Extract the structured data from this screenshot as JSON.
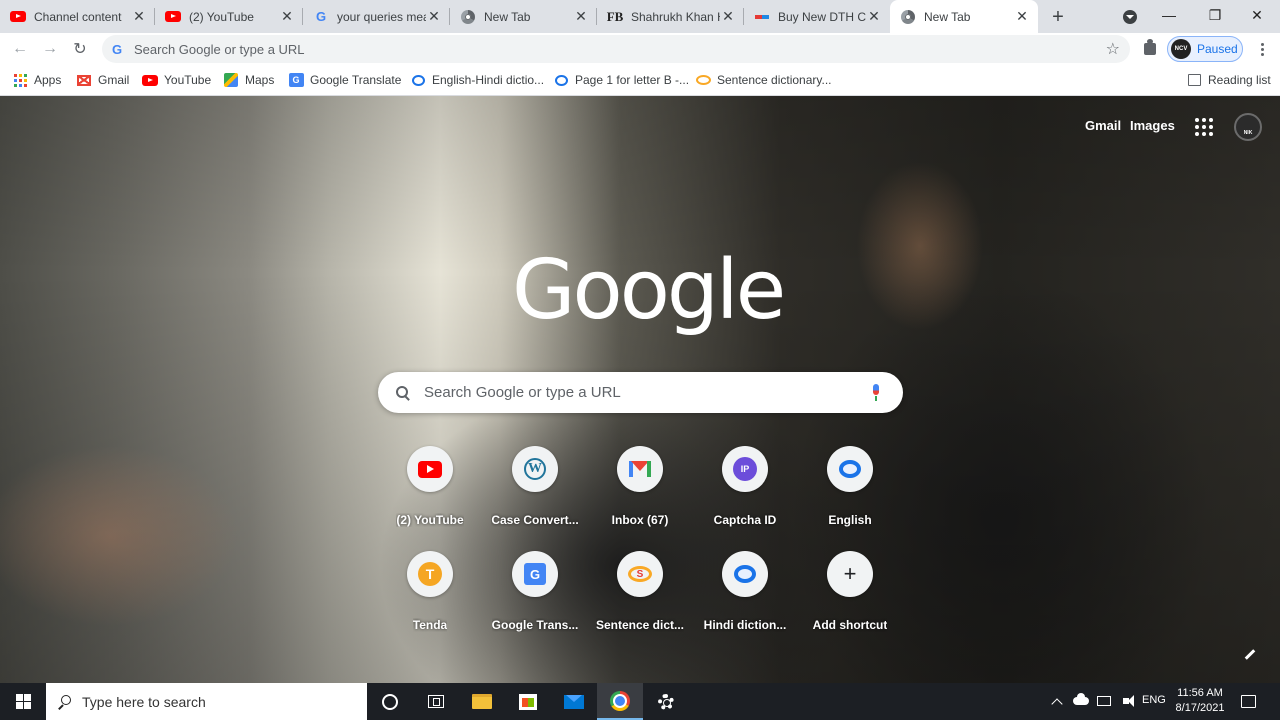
{
  "window": {
    "tabs": [
      {
        "title": "Channel content",
        "favicon": "youtube-icon",
        "active": false
      },
      {
        "title": "(2) YouTube",
        "favicon": "youtube-icon",
        "active": false
      },
      {
        "title": "your queries mea",
        "favicon": "google-icon",
        "active": false
      },
      {
        "title": "New Tab",
        "favicon": "chrome-icon",
        "active": false
      },
      {
        "title": "Shahrukh Khan H",
        "favicon": "fb-icon",
        "active": false
      },
      {
        "title": "Buy New DTH Co",
        "favicon": "dth-icon",
        "active": false
      },
      {
        "title": "New Tab",
        "favicon": "chrome-icon",
        "active": true
      }
    ],
    "new_tab_symbol": "+",
    "controls": {
      "minimize": "—",
      "maximize": "❐",
      "close": "✕"
    }
  },
  "toolbar": {
    "back": "←",
    "forward": "→",
    "reload": "↻",
    "omnibox_placeholder": "Search Google or type a URL",
    "bookmark_star": "☆",
    "profile_badge": "NCV",
    "profile_status": "Paused"
  },
  "bookmarks": {
    "items": [
      {
        "label": "Apps",
        "icon": "apps-grid-icon"
      },
      {
        "label": "Gmail",
        "icon": "gmail-icon"
      },
      {
        "label": "YouTube",
        "icon": "youtube-icon"
      },
      {
        "label": "Maps",
        "icon": "maps-icon"
      },
      {
        "label": "Google Translate",
        "icon": "google-translate-icon"
      },
      {
        "label": "English-Hindi dictio...",
        "icon": "speech-bubble-icon"
      },
      {
        "label": "Page 1 for letter B -...",
        "icon": "speech-bubble-icon"
      },
      {
        "label": "Sentence dictionary...",
        "icon": "sentence-dictionary-icon"
      }
    ],
    "reading_list": "Reading list"
  },
  "ntp": {
    "top_links": {
      "gmail": "Gmail",
      "images": "Images"
    },
    "avatar_caption": "NIK",
    "logo": "Google",
    "search_placeholder": "Search Google or type a URL",
    "shortcuts": [
      {
        "label": "(2) YouTube",
        "icon": "youtube-icon"
      },
      {
        "label": "Case Convert...",
        "icon": "wordpress-icon"
      },
      {
        "label": "Inbox (67)",
        "icon": "gmail-icon"
      },
      {
        "label": "Captcha ID",
        "icon": "ip-icon",
        "glyph": "IP"
      },
      {
        "label": "English",
        "icon": "speech-bubble-icon"
      },
      {
        "label": "Tenda",
        "icon": "tenda-icon",
        "glyph": "T"
      },
      {
        "label": "Google Trans...",
        "icon": "google-translate-icon",
        "glyph": "G"
      },
      {
        "label": "Sentence dict...",
        "icon": "sentence-dictionary-icon",
        "glyph": "S"
      },
      {
        "label": "Hindi diction...",
        "icon": "speech-bubble-icon"
      },
      {
        "label": "Add shortcut",
        "icon": "plus-icon",
        "glyph": "+"
      }
    ]
  },
  "taskbar": {
    "search_placeholder": "Type here to search",
    "language": "ENG",
    "time": "11:56 AM",
    "date": "8/17/2021"
  },
  "colors": {
    "tab_strip": "#dee1e6",
    "accent_blue": "#1a73e8",
    "taskbar": "#1c1f24"
  }
}
